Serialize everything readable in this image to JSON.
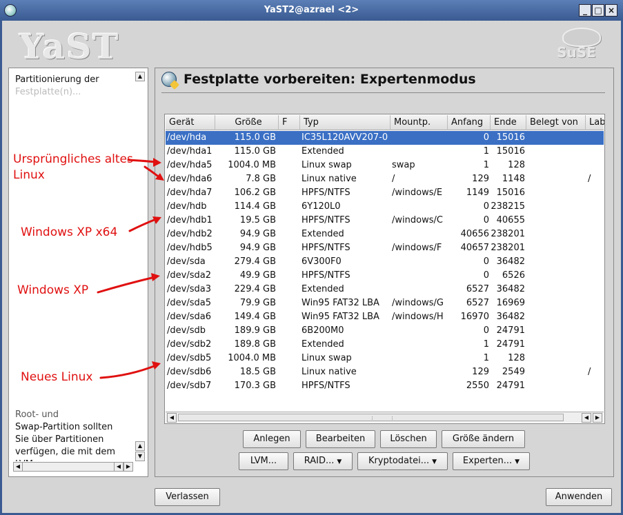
{
  "window": {
    "title": "YaST2@azrael <2>",
    "controls": [
      "_",
      "□",
      "×"
    ]
  },
  "logos": {
    "yast": "YaST",
    "suse": "SuSE"
  },
  "help": {
    "lines": [
      "Partitionierung der",
      "Festplatte(n)...",
      "Root- und",
      "Swap-Partition sollten",
      "Sie über Partitionen",
      "verfügen, die mit dem",
      "LVM..."
    ]
  },
  "annotations": [
    "Ursprüngliches altes",
    "Linux",
    "Windows XP x64",
    "Windows XP",
    "Neues Linux"
  ],
  "main": {
    "heading": "Festplatte vorbereiten: Expertenmodus",
    "columns": [
      "Gerät",
      "Größe",
      "F",
      "Typ",
      "Mountp.",
      "Anfang",
      "Ende",
      "Belegt von",
      "Lab"
    ],
    "rows": [
      {
        "dev": "/dev/hda",
        "size": "115.0 GB",
        "f": "",
        "type": "IC35L120AVV207-0",
        "mount": "",
        "start": "0",
        "end": "15016",
        "used": "",
        "label": ""
      },
      {
        "dev": "/dev/hda1",
        "size": "115.0 GB",
        "f": "",
        "type": "Extended",
        "mount": "",
        "start": "1",
        "end": "15016",
        "used": "",
        "label": ""
      },
      {
        "dev": "/dev/hda5",
        "size": "1004.0 MB",
        "f": "",
        "type": "Linux swap",
        "mount": "swap",
        "start": "1",
        "end": "128",
        "used": "",
        "label": ""
      },
      {
        "dev": "/dev/hda6",
        "size": "7.8 GB",
        "f": "",
        "type": "Linux native",
        "mount": "/",
        "start": "129",
        "end": "1148",
        "used": "",
        "label": "/"
      },
      {
        "dev": "/dev/hda7",
        "size": "106.2 GB",
        "f": "",
        "type": "HPFS/NTFS",
        "mount": "/windows/E",
        "start": "1149",
        "end": "15016",
        "used": "",
        "label": ""
      },
      {
        "dev": "/dev/hdb",
        "size": "114.4 GB",
        "f": "",
        "type": "6Y120L0",
        "mount": "",
        "start": "0",
        "end": "238215",
        "used": "",
        "label": ""
      },
      {
        "dev": "/dev/hdb1",
        "size": "19.5 GB",
        "f": "",
        "type": "HPFS/NTFS",
        "mount": "/windows/C",
        "start": "0",
        "end": "40655",
        "used": "",
        "label": ""
      },
      {
        "dev": "/dev/hdb2",
        "size": "94.9 GB",
        "f": "",
        "type": "Extended",
        "mount": "",
        "start": "40656",
        "end": "238201",
        "used": "",
        "label": ""
      },
      {
        "dev": "/dev/hdb5",
        "size": "94.9 GB",
        "f": "",
        "type": "HPFS/NTFS",
        "mount": "/windows/F",
        "start": "40657",
        "end": "238201",
        "used": "",
        "label": ""
      },
      {
        "dev": "/dev/sda",
        "size": "279.4 GB",
        "f": "",
        "type": "6V300F0",
        "mount": "",
        "start": "0",
        "end": "36482",
        "used": "",
        "label": ""
      },
      {
        "dev": "/dev/sda2",
        "size": "49.9 GB",
        "f": "",
        "type": "HPFS/NTFS",
        "mount": "",
        "start": "0",
        "end": "6526",
        "used": "",
        "label": ""
      },
      {
        "dev": "/dev/sda3",
        "size": "229.4 GB",
        "f": "",
        "type": "Extended",
        "mount": "",
        "start": "6527",
        "end": "36482",
        "used": "",
        "label": ""
      },
      {
        "dev": "/dev/sda5",
        "size": "79.9 GB",
        "f": "",
        "type": "Win95 FAT32 LBA",
        "mount": "/windows/G",
        "start": "6527",
        "end": "16969",
        "used": "",
        "label": ""
      },
      {
        "dev": "/dev/sda6",
        "size": "149.4 GB",
        "f": "",
        "type": "Win95 FAT32 LBA",
        "mount": "/windows/H",
        "start": "16970",
        "end": "36482",
        "used": "",
        "label": ""
      },
      {
        "dev": "/dev/sdb",
        "size": "189.9 GB",
        "f": "",
        "type": "6B200M0",
        "mount": "",
        "start": "0",
        "end": "24791",
        "used": "",
        "label": ""
      },
      {
        "dev": "/dev/sdb2",
        "size": "189.8 GB",
        "f": "",
        "type": "Extended",
        "mount": "",
        "start": "1",
        "end": "24791",
        "used": "",
        "label": ""
      },
      {
        "dev": "/dev/sdb5",
        "size": "1004.0 MB",
        "f": "",
        "type": "Linux swap",
        "mount": "",
        "start": "1",
        "end": "128",
        "used": "",
        "label": ""
      },
      {
        "dev": "/dev/sdb6",
        "size": "18.5 GB",
        "f": "",
        "type": "Linux native",
        "mount": "",
        "start": "129",
        "end": "2549",
        "used": "",
        "label": "/"
      },
      {
        "dev": "/dev/sdb7",
        "size": "170.3 GB",
        "f": "",
        "type": "HPFS/NTFS",
        "mount": "",
        "start": "2550",
        "end": "24791",
        "used": "",
        "label": ""
      }
    ],
    "selected_row": 0,
    "buttons_row1": [
      "Anlegen",
      "Bearbeiten",
      "Löschen",
      "Größe ändern"
    ],
    "buttons_row2": [
      "LVM...",
      "RAID...",
      "Kryptodatei...",
      "Experten..."
    ]
  },
  "footer": {
    "left_button": "Verlassen",
    "right_button": "Anwenden"
  },
  "colors": {
    "selection": "#3a6fc4",
    "annotation": "#e01010",
    "titlebar": "#3a5a92"
  }
}
